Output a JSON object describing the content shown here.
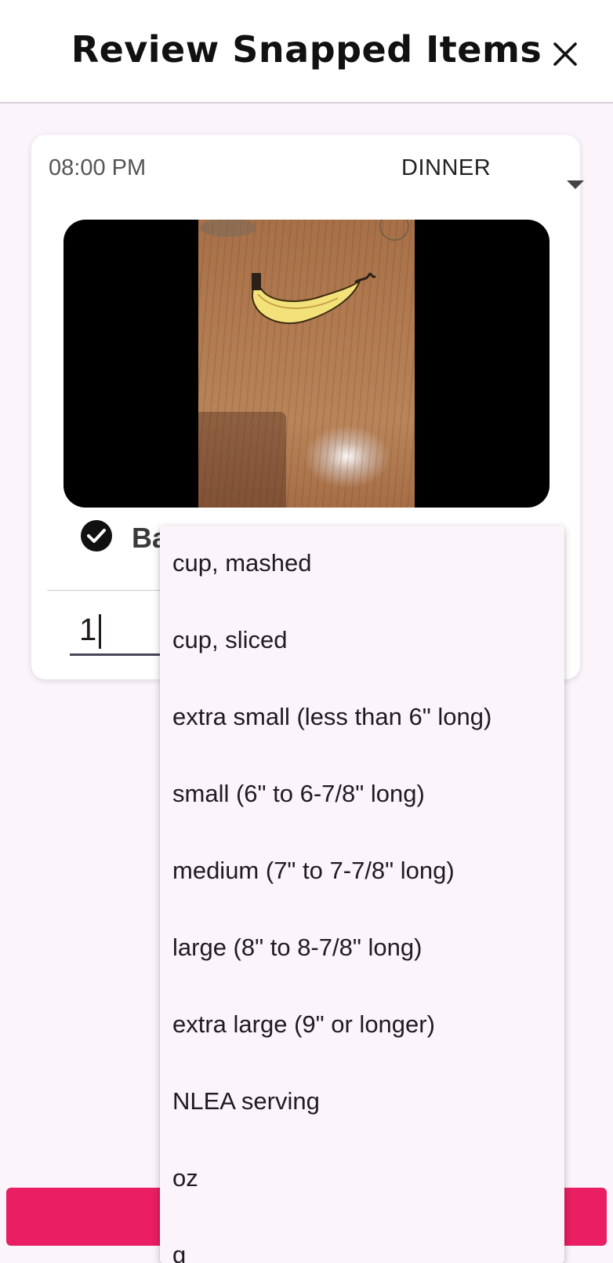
{
  "header": {
    "title": "Review Snapped Items",
    "close_icon": "close-icon"
  },
  "item": {
    "time": "08:00 PM",
    "meal": "DINNER",
    "meal_dropdown_icon": "arrow-drop-down-icon",
    "photo_description": "banana",
    "selected_icon": "check-circle-icon",
    "name_visible": "Ba",
    "quantity": "1"
  },
  "unit_dropdown": {
    "options": [
      "cup, mashed",
      "cup, sliced",
      "extra small (less than 6\" long)",
      "small (6\" to 6-7/8\" long)",
      "medium (7\" to 7-7/8\" long)",
      "large (8\" to 8-7/8\" long)",
      "extra large (9\" or longer)",
      "NLEA serving",
      "oz",
      "g"
    ]
  },
  "colors": {
    "accent": "#e91e63",
    "background": "#fcf4fb"
  }
}
